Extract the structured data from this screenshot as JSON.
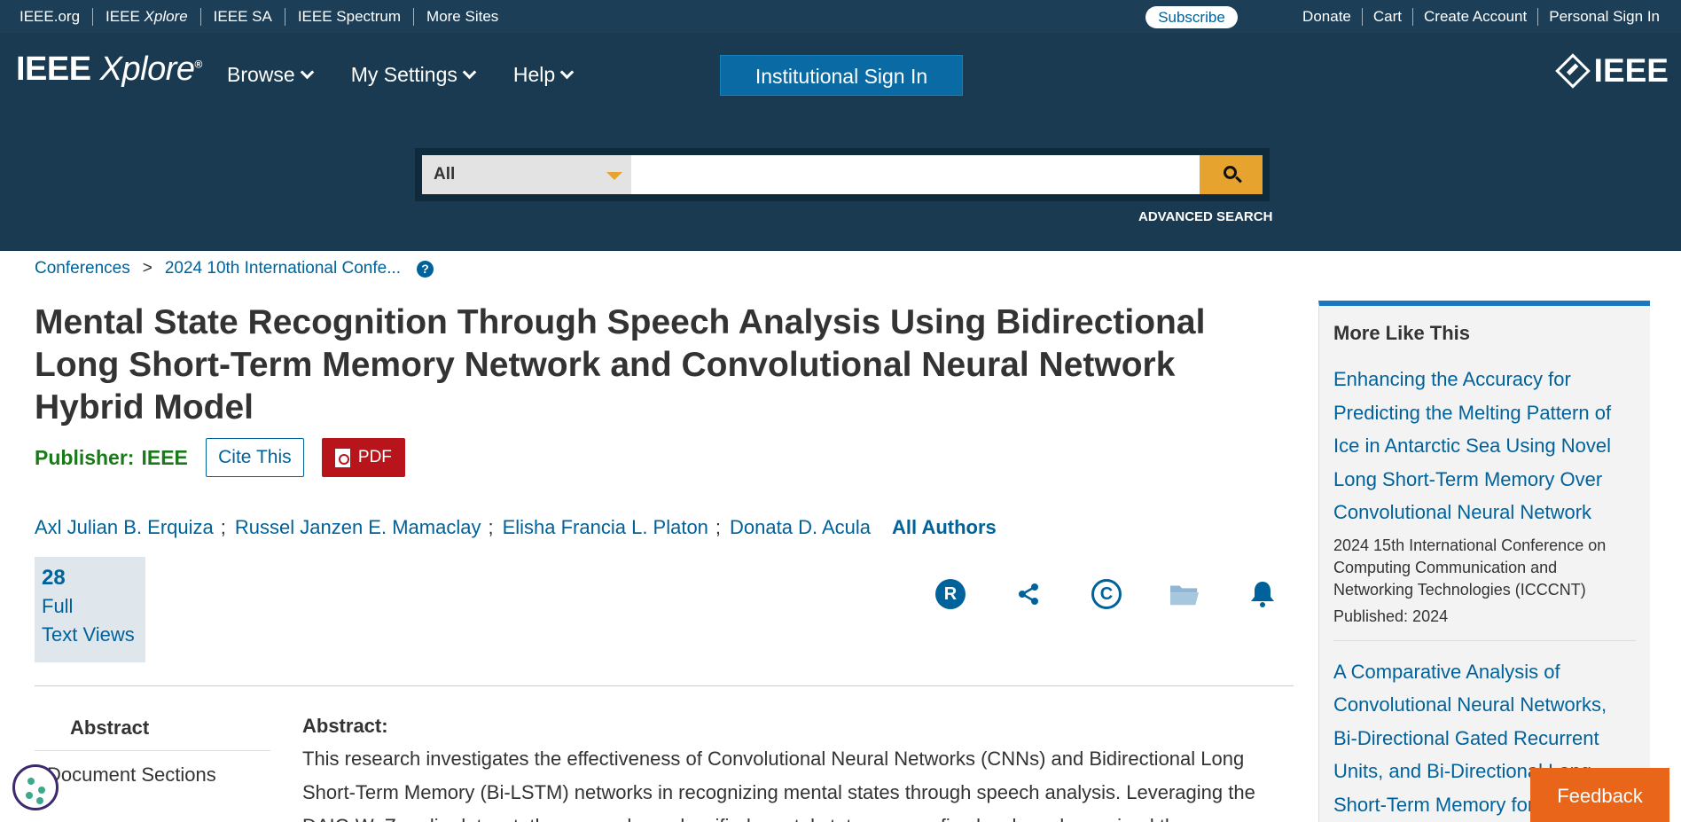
{
  "topbar": {
    "links_left": [
      "IEEE.org",
      "IEEE",
      "IEEE SA",
      "IEEE Spectrum",
      "More Sites"
    ],
    "xplore_word": "Xplore",
    "subscribe": "Subscribe",
    "links_right": [
      "Donate",
      "Cart",
      "Create Account",
      "Personal Sign In"
    ]
  },
  "header": {
    "logo_ieee": "IEEE",
    "logo_xplore": "Xplore",
    "logo_reg": "®",
    "nav": [
      "Browse",
      "My Settings",
      "Help"
    ],
    "institutional_sign_in": "Institutional Sign In",
    "ieee_brand": "IEEE"
  },
  "search": {
    "scope": "All",
    "placeholder": "",
    "advanced": "ADVANCED SEARCH"
  },
  "breadcrumb": {
    "items": [
      "Conferences",
      "2024 10th International Confe..."
    ],
    "separator": ">",
    "help": "?"
  },
  "paper": {
    "title": "Mental State Recognition Through Speech Analysis Using Bidirectional Long Short-Term Memory Network and Convolutional Neural Network Hybrid Model",
    "publisher_label": "Publisher:",
    "publisher": "IEEE",
    "cite_this": "Cite This",
    "pdf": "PDF",
    "authors": [
      "Axl Julian B. Erquiza",
      "Russel Janzen E. Mamaclay",
      "Elisha Francia L. Platon",
      "Donata D. Acula"
    ],
    "all_authors": "All Authors",
    "views": {
      "count": "28",
      "line1": "Full",
      "line2": "Text Views"
    }
  },
  "tools": [
    "r-icon",
    "share-icon",
    "copyright-icon",
    "folder-icon",
    "bell-icon"
  ],
  "sidenav": {
    "abstract": "Abstract",
    "sections": "Document Sections"
  },
  "abstract": {
    "heading": "Abstract:",
    "text": "This research investigates the effectiveness of Convolutional Neural Networks (CNNs) and Bidirectional Long Short-Term Memory (Bi-LSTM) networks in recognizing mental states through speech analysis. Leveraging the DAIC-WoZ audio dataset, the researchers classified mental states across five levels and examined the"
  },
  "more_like_this": {
    "heading": "More Like This",
    "articles": [
      {
        "title": "Enhancing the Accuracy for Predicting the Melting Pattern of Ice in Antarctic Sea Using Novel Long Short-Term Memory Over Convolutional Neural Network",
        "conference": "2024 15th International Conference on Computing Communication and Networking Technologies (ICCCNT)",
        "published": "Published: 2024"
      },
      {
        "title": "A Comparative Analysis of Convolutional Neural Networks, Bi-Directional Gated Recurrent Units, and Bi-Directional Long Short-Term Memory for"
      }
    ]
  },
  "feedback": "Feedback",
  "colors": {
    "header": "#193a50",
    "topbar": "#1c3e56",
    "link": "#00629b",
    "accent": "#e6a32d",
    "pdf": "#b7141b",
    "feedback": "#e8651a"
  }
}
